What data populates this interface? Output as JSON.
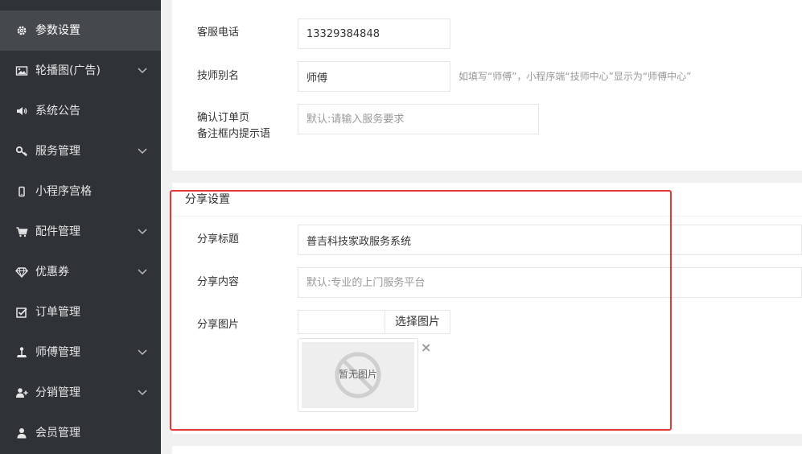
{
  "sidebar": {
    "items": [
      {
        "label": "参数设置",
        "icon": "gear-icon",
        "has_submenu": false,
        "active": true
      },
      {
        "label": "轮播图(广告)",
        "icon": "image-icon",
        "has_submenu": true
      },
      {
        "label": "系统公告",
        "icon": "speaker-icon",
        "has_submenu": false
      },
      {
        "label": "服务管理",
        "icon": "key-icon",
        "has_submenu": true
      },
      {
        "label": "小程序宫格",
        "icon": "mobile-icon",
        "has_submenu": false
      },
      {
        "label": "配件管理",
        "icon": "cart-icon",
        "has_submenu": true
      },
      {
        "label": "优惠券",
        "icon": "diamond-icon",
        "has_submenu": true
      },
      {
        "label": "订单管理",
        "icon": "checkbox-icon",
        "has_submenu": false
      },
      {
        "label": "师傅管理",
        "icon": "joystick-icon",
        "has_submenu": true
      },
      {
        "label": "分销管理",
        "icon": "user-plus-icon",
        "has_submenu": true
      },
      {
        "label": "会员管理",
        "icon": "user-icon",
        "has_submenu": false
      }
    ]
  },
  "basic": {
    "phone_label": "客服电话",
    "phone_value": "13329384848",
    "alias_label": "技师别名",
    "alias_value": "师傅",
    "alias_hint": "如填写“师傅”，小程序端“技师中心”显示为“师傅中心”",
    "remark_label_1": "确认订单页",
    "remark_label_2": "备注框内提示语",
    "remark_placeholder": "默认:请输入服务要求"
  },
  "share": {
    "title": "分享设置",
    "share_title_label": "分享标题",
    "share_title_value": "普吉科技家政服务系统",
    "share_content_label": "分享内容",
    "share_content_placeholder": "默认:专业的上门服务平台",
    "share_image_label": "分享图片",
    "choose_image_label": "选择图片",
    "no_image_text": "暂无图片",
    "close_symbol": "×"
  },
  "colors": {
    "sidebar_bg": "#2f3237",
    "sidebar_active": "#45484d",
    "highlight_border": "#e53935"
  }
}
